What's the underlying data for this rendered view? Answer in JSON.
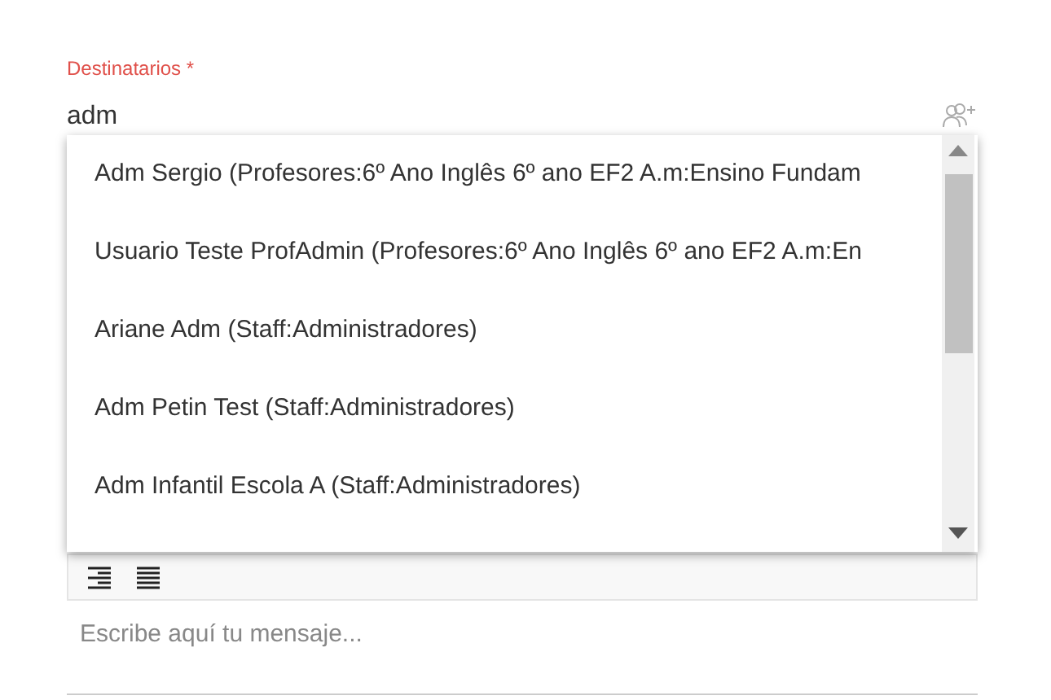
{
  "recipients": {
    "label": "Destinatarios *",
    "value": "adm"
  },
  "suggestions": [
    {
      "text": "Adm Sergio (Profesores:6º Ano Inglês 6º ano EF2 A.m:Ensino Fundam"
    },
    {
      "text": "Usuario Teste ProfAdmin (Profesores:6º Ano Inglês 6º ano EF2 A.m:En"
    },
    {
      "text": "Ariane Adm (Staff:Administradores)"
    },
    {
      "text": "Adm Petin Test (Staff:Administradores)"
    },
    {
      "text": "Adm Infantil Escola A (Staff:Administradores)"
    }
  ],
  "editor": {
    "toolbar": [
      {
        "kind": "align-right"
      },
      {
        "kind": "justify"
      }
    ],
    "placeholder": "Escribe aquí tu mensaje..."
  }
}
